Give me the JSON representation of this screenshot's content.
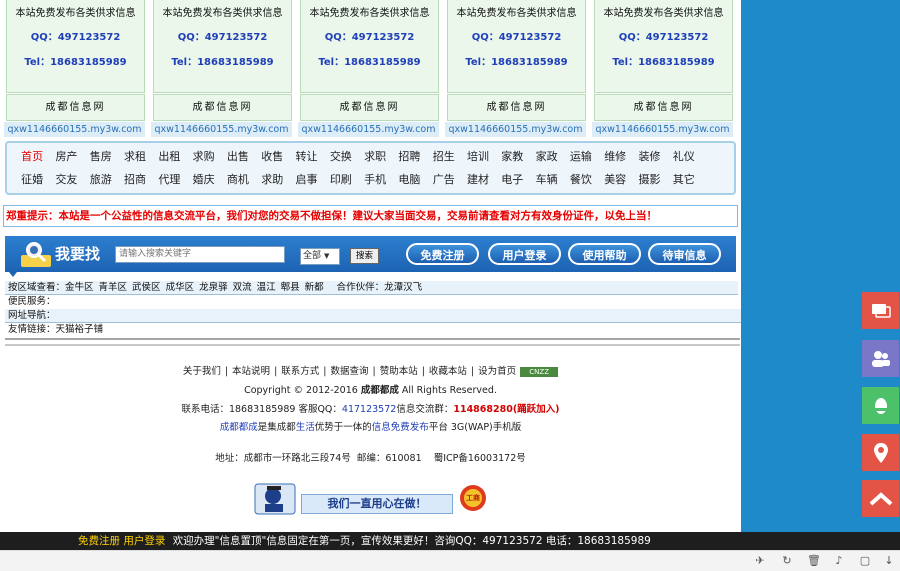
{
  "ads": {
    "line1": "本站免费发布各类供求信息",
    "qq": "QQ：497123572",
    "tel": "Tel：18683185989",
    "name": "成都信息网",
    "url": "qxw1146660155.my3w.com"
  },
  "categories": {
    "row1": [
      "首页",
      "房产",
      "售房",
      "求租",
      "出租",
      "求购",
      "出售",
      "收售",
      "转让",
      "交换",
      "求职",
      "招聘",
      "招生",
      "培训",
      "家教",
      "家政",
      "运输",
      "维修",
      "装修",
      "礼仪"
    ],
    "row2": [
      "征婚",
      "交友",
      "旅游",
      "招商",
      "代理",
      "婚庆",
      "商机",
      "求助",
      "启事",
      "印刷",
      "手机",
      "电脑",
      "广告",
      "建材",
      "电子",
      "车辆",
      "餐饮",
      "美容",
      "摄影",
      "其它"
    ]
  },
  "warning": "郑重提示：本站是一个公益性的信息交流平台，我们对您的交易不做担保！建议大家当面交易，交易前请查看对方有效身份证件，以免上当！",
  "search": {
    "title": "我要找",
    "placeholder": "请输入搜索关键字",
    "scope": "全部",
    "button": "搜索",
    "pills": [
      "免费注册",
      "用户登录",
      "使用帮助",
      "待审信息"
    ]
  },
  "rows": {
    "region_label": "按区域查看：",
    "regions": [
      "金牛区",
      "青羊区",
      "武侯区",
      "成华区",
      "龙泉驿",
      "双流",
      "温江",
      "郫县",
      "新都"
    ],
    "partner_label": "合作伙伴：",
    "partner": "龙潭汉飞",
    "service": "便民服务：",
    "nav": "网址导航：",
    "friends_label": "友情链接：",
    "friend": "天猫裕子铺"
  },
  "footer": {
    "links": [
      "关于我们",
      "本站说明",
      "联系方式",
      "数据查询",
      "赞助本站",
      "收藏本站",
      "设为首页"
    ],
    "link_sep": "|",
    "cnzz": "CNZZ",
    "copyright_pre": "Copyright © 2012-2016 ",
    "copyright_brand": "成都都成",
    "copyright_post": " All Rights Reserved.",
    "contact_pre": "联系电话：18683185989 客服QQ：",
    "contact_qq": "417123572",
    "contact_mid": "信息交流群：",
    "contact_group": "114868280(踊跃加入)",
    "intro_brand": "成都都成",
    "intro_1": "是集成都",
    "intro_life": "生活",
    "intro_2": "优势于一体的",
    "intro_free": "信息免费发布",
    "intro_3": "平台 3G(WAP)手机版",
    "address": "地址：成都市一环路北三段74号  邮编：610081    蜀ICP备16003172号",
    "badge_text": "我们一直用心在做！",
    "badge_seal": "工商"
  },
  "bottombar": {
    "register": "免费注册",
    "login": "用户登录",
    "notice": "欢迎办理\"信息置顶\"信息固定在第一页，宣传效果更好！咨询QQ：497123572 电话：18683185989"
  },
  "colors": {
    "accent_blue": "#1f8ac9",
    "warning_red": "#e60000",
    "float_red": "#e35446",
    "float_purple": "#7a77c8",
    "float_green": "#4cc16a"
  }
}
